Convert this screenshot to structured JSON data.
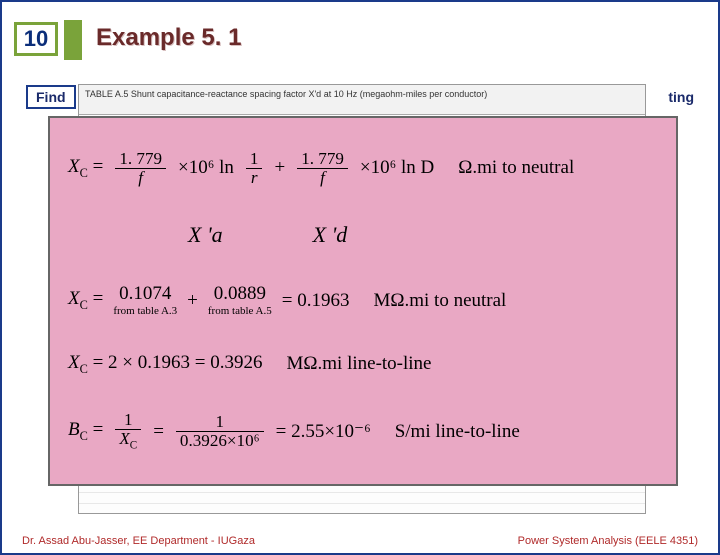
{
  "page_number": "10",
  "title": "Example 5. 1",
  "find_label": "Find",
  "trailing_fragment": "ting",
  "table_caption": "TABLE A.5  Shunt capacitance-reactance spacing factor X'd at 10 Hz (megaohm-miles per conductor)",
  "formulas": {
    "line1_lhs": "X",
    "line1_lhs_sub": "C",
    "line1_frac1_num": "1. 779",
    "line1_frac1_den": "f",
    "line1_sci": "×10⁶ ln",
    "line1_frac2_num": "1",
    "line1_frac2_den": "r",
    "line1_plus": "+",
    "line1_frac3_num": "1. 779",
    "line1_frac3_den": "f",
    "line1_lnD": "×10⁶ ln D",
    "line1_unit": "Ω.mi to neutral",
    "mid_xa": "X 'a",
    "mid_xd": "X 'd",
    "line2_lhs": "X",
    "line2_lhs_sub": "C",
    "line2_term1_brace_a": "0.1074",
    "line2_note_a": "from table A.3",
    "line2_plus2": "+",
    "line2_term2_brace_b": "0.0889",
    "line2_note_b": "from table A.5",
    "line2_eq": "= 0.1963",
    "line2_unit": "MΩ.mi to neutral",
    "line3": "X_C = 2 × 0.1963 = 0.3926",
    "line3_unit": "MΩ.mi line-to-line",
    "line4_lhs": "B",
    "line4_lhs_sub": "C",
    "line4_frac1_num": "1",
    "line4_frac1_den_sym": "X",
    "line4_frac1_den_sub": "C",
    "line4_eq": "=",
    "line4_frac2_num": "1",
    "line4_frac2_den": "0.3926×10⁶",
    "line4_result": "= 2.55×10⁻⁶",
    "line4_unit": "S/mi line-to-line"
  },
  "footer_left": "Dr. Assad Abu-Jasser, EE Department - IUGaza",
  "footer_right": "Power System Analysis (EELE 4351)"
}
